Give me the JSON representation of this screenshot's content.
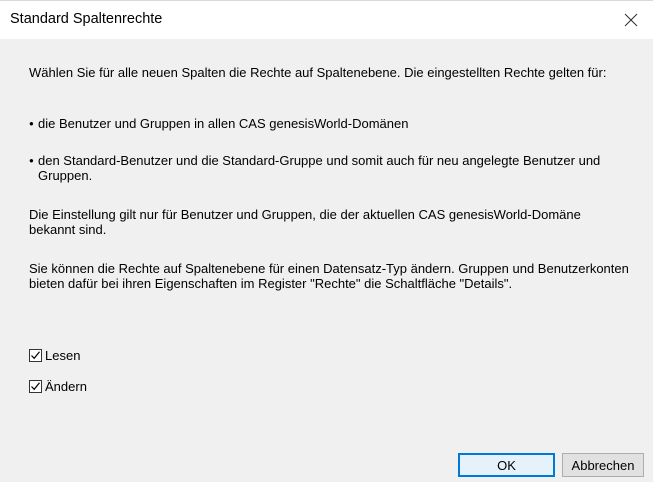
{
  "dialog": {
    "title": "Standard Spaltenrechte",
    "close_icon": "close-icon",
    "intro": "Wählen Sie für alle neuen Spalten die Rechte auf Spaltenebene. Die eingestellten Rechte gelten für:",
    "bullets": [
      "die Benutzer und Gruppen in allen CAS genesisWorld-Domänen",
      "den Standard-Benutzer und die Standard-Gruppe und somit auch für neu angelegte Benutzer und Gruppen."
    ],
    "bullet_symbol": "●",
    "note1": "Die Einstellung gilt nur für Benutzer und Gruppen, die der aktuellen CAS genesisWorld-Domäne bekannt sind.",
    "note2": "Sie können die Rechte auf Spaltenebene für einen Datensatz-Typ ändern. Gruppen und Benutzerkonten bieten dafür bei ihren Eigenschaften im Register \"Rechte\" die Schaltfläche \"Details\".",
    "checkboxes": [
      {
        "label": "Lesen",
        "checked": true
      },
      {
        "label": "Ändern",
        "checked": true
      }
    ],
    "ok_label": "OK",
    "cancel_label": "Abbrechen"
  }
}
